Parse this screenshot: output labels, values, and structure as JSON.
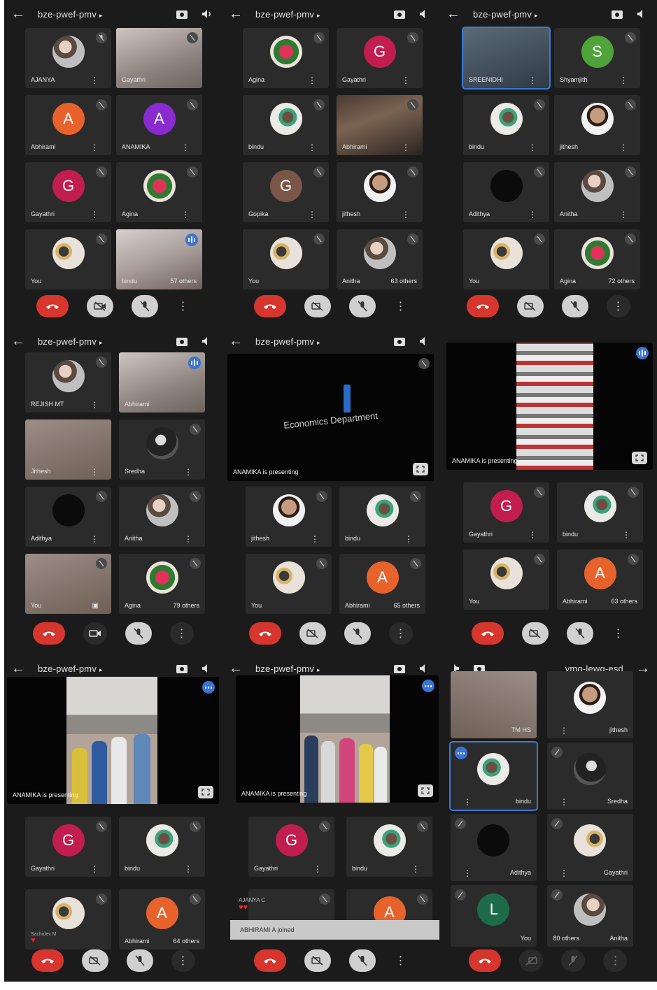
{
  "meeting_code": "bze-pwef-pmv",
  "meeting_code_mirrored": "vmq-lewq-esd",
  "p1": {
    "tiles": [
      {
        "name": "AJANYA"
      },
      {
        "name": "Gayathri"
      },
      {
        "name": "Abhirami",
        "letter": "A"
      },
      {
        "name": "ANAMIKA",
        "letter": "A"
      },
      {
        "name": "Gayathri",
        "letter": "G"
      },
      {
        "name": "Agina"
      },
      {
        "name": "You"
      },
      {
        "name": "bindu",
        "others": "57 others"
      }
    ]
  },
  "p2": {
    "tiles": [
      {
        "name": "Agina"
      },
      {
        "name": "Gayathri",
        "letter": "G"
      },
      {
        "name": "bindu"
      },
      {
        "name": "Abhirami"
      },
      {
        "name": "Gopika",
        "letter": "G"
      },
      {
        "name": "jithesh"
      },
      {
        "name": "You"
      },
      {
        "name": "Anitha",
        "others": "63 others"
      }
    ]
  },
  "p3": {
    "tiles": [
      {
        "name": "SREENIDHI"
      },
      {
        "name": "Shyamjith",
        "letter": "S"
      },
      {
        "name": "bindu"
      },
      {
        "name": "jithesh"
      },
      {
        "name": "Adithya"
      },
      {
        "name": "Anitha"
      },
      {
        "name": "You"
      },
      {
        "name": "Agina",
        "others": "72 others"
      }
    ]
  },
  "p4": {
    "tiles": [
      {
        "name": "REJISH MT"
      },
      {
        "name": "Abhirami"
      },
      {
        "name": "Jithesh"
      },
      {
        "name": "Sredha"
      },
      {
        "name": "Adithya"
      },
      {
        "name": "Anitha"
      },
      {
        "name": "You"
      },
      {
        "name": "Agina",
        "others": "79 others"
      }
    ]
  },
  "p5": {
    "presenting": "ANAMIKA is presenting",
    "slide_text": "Economics Department",
    "tiles": [
      {
        "name": "jithesh"
      },
      {
        "name": "bindu"
      },
      {
        "name": "You"
      },
      {
        "name": "Abhirami",
        "letter": "A",
        "others": "65 others"
      }
    ]
  },
  "p6": {
    "presenting": "ANAMIKA is presenting",
    "tiles": [
      {
        "name": "Gayathri",
        "letter": "G"
      },
      {
        "name": "bindu"
      },
      {
        "name": "You"
      },
      {
        "name": "Abhirami",
        "letter": "A",
        "others": "63 others"
      }
    ]
  },
  "p7": {
    "presenting": "ANAMIKA is presenting",
    "tiles": [
      {
        "name": "Gayathri",
        "letter": "G"
      },
      {
        "name": "bindu"
      },
      {
        "name": "Sachidev M"
      },
      {
        "name": "Abhirami",
        "letter": "A",
        "others": "64 others"
      }
    ]
  },
  "p8": {
    "presenting": "ANAMIKA is presenting",
    "reaction_name": "AJANYA C",
    "toast": "ABHIRAMI A joined",
    "tiles": [
      {
        "name": "Gayathri",
        "letter": "G"
      },
      {
        "name": "bindu"
      },
      {
        "name": ""
      },
      {
        "name": "",
        "letter": "A"
      }
    ]
  },
  "p9": {
    "tiles": [
      {
        "name": "jithesh"
      },
      {
        "name": "TM HS"
      },
      {
        "name": "Sredha"
      },
      {
        "name": "bindu"
      },
      {
        "name": "Gayathri"
      },
      {
        "name": "Adithya"
      },
      {
        "name": "Anitha",
        "others": "80 others"
      },
      {
        "name": "You",
        "letter": "L"
      }
    ]
  },
  "colors": {
    "end_call": "#d6362d",
    "accent": "#3b73d4",
    "bg": "#1b1b1b",
    "tile": "#2b2b2b"
  }
}
